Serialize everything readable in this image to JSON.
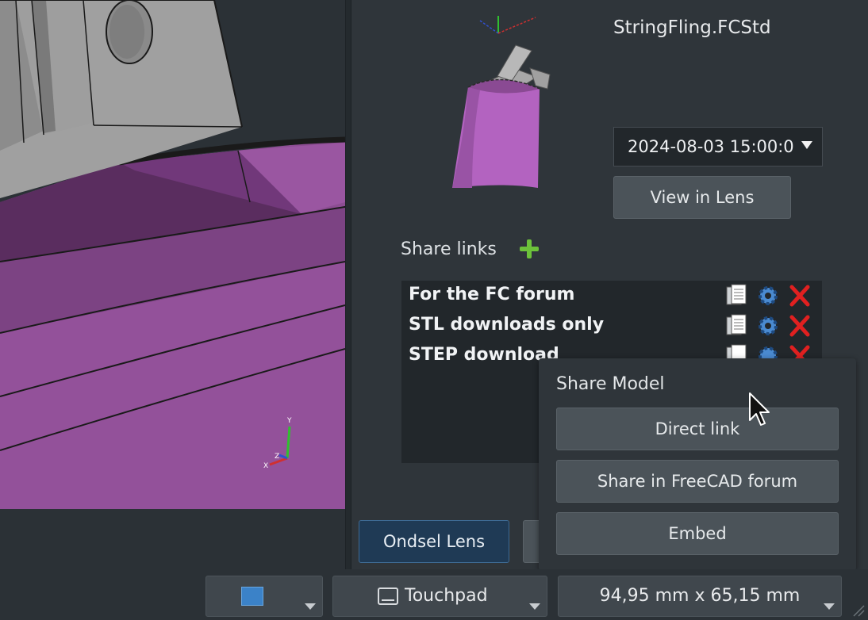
{
  "panel": {
    "filename": "StringFling.FCStd",
    "version": "2024-08-03 15:00:0",
    "view_in_lens": "View in Lens",
    "share_links_label": "Share links",
    "links": [
      {
        "label": "For the FC forum"
      },
      {
        "label": "STL downloads only"
      },
      {
        "label": "STEP download"
      }
    ],
    "ondsel_lens_tab": "Ondsel Lens"
  },
  "share_menu": {
    "title": "Share Model",
    "direct_link": "Direct link",
    "share_forum": "Share in FreeCAD forum",
    "embed": "Embed"
  },
  "statusbar": {
    "touchpad": "Touchpad",
    "dimensions": "94,95 mm x 65,15 mm"
  },
  "axis": {
    "x": "X",
    "y": "Y",
    "z": "Z"
  },
  "icons": {
    "add": "plus-icon",
    "copy": "copy-icon",
    "settings": "gear-icon",
    "delete": "delete-icon",
    "mail": "mail-icon",
    "touchpad": "touchpad-icon"
  },
  "colors": {
    "model_purple": "#8c4d92",
    "part_gray": "#9c9c9c",
    "accent_green": "#6cc23a",
    "delete_red": "#e02020",
    "gear_blue": "#4a8ad0",
    "lens_tab": "#1f3a55"
  }
}
